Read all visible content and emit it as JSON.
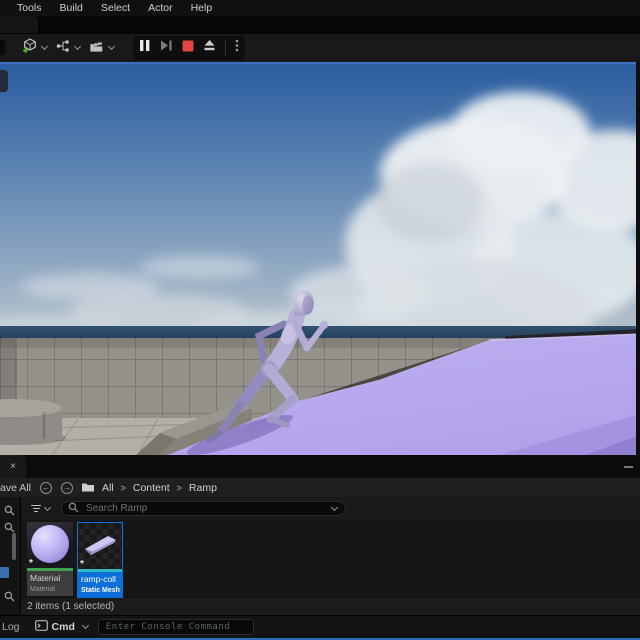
{
  "menubar": {
    "items": [
      "Tools",
      "Build",
      "Select",
      "Actor",
      "Help"
    ]
  },
  "toolbar": {
    "buttons": [
      {
        "name": "add-actor",
        "icon": "cube-plus"
      },
      {
        "name": "blueprints",
        "icon": "node-graph"
      },
      {
        "name": "cinematics",
        "icon": "clapperboard"
      }
    ],
    "play_controls": [
      "pause",
      "frame-step",
      "stop",
      "eject",
      "options"
    ]
  },
  "icons": {
    "close": "×",
    "star": "*",
    "back_arrow": "←",
    "forward_arrow": "→"
  },
  "content_drawer": {
    "save_all_label": "ave All",
    "breadcrumb": {
      "items": [
        "All",
        "Content",
        "Ramp"
      ],
      "separator": ">"
    },
    "search": {
      "placeholder": "Search Ramp"
    },
    "assets": [
      {
        "name": "Material",
        "type": "Material",
        "selected": false
      },
      {
        "name": "ramp-coll",
        "type": "Static Mesh",
        "selected": true
      }
    ],
    "status_text": "2 items (1 selected)"
  },
  "status_bar": {
    "log_label": "Log",
    "cmd_label": "Cmd",
    "console_placeholder": "Enter Console Command"
  },
  "colors": {
    "accent": "#0f6fd8",
    "stop_red": "#e0463f",
    "material_bar": "#3fa34d",
    "mesh_bar": "#2fb7c6",
    "ramp": "#beb0f2",
    "ramp_low": "#b2a2ea",
    "ramp_shade": "#a593e2",
    "ramp_deep": "#9080cf",
    "sky_top": "#2a5c9f",
    "sky_mid": "#557fb0",
    "sky_low": "#8aa4c0",
    "sky_horizon": "#b5c1cb",
    "ocean": "#33526f",
    "ocean_deep": "#22405a",
    "wall": "#94908a",
    "floor": "#b3aea7",
    "viewport_outline": "#3b6fc0",
    "mannequin": "#b6afd6"
  }
}
